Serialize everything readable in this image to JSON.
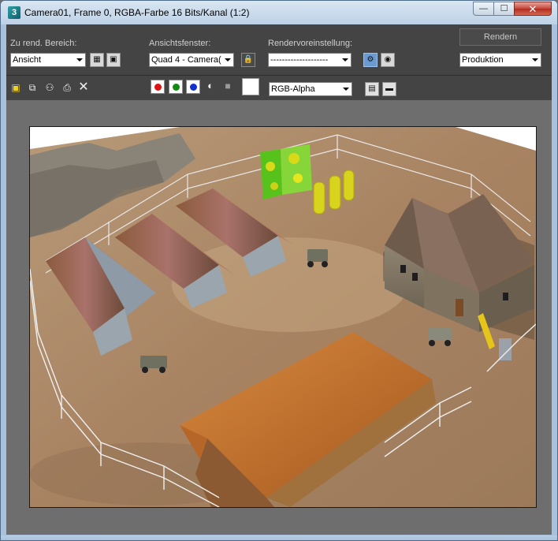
{
  "window": {
    "title": "Camera01, Frame 0, RGBA-Farbe 16 Bits/Kanal (1:2)",
    "app_icon_glyph": "3",
    "minimize_glyph": "—",
    "maximize_glyph": "☐",
    "close_glyph": "✕"
  },
  "toolbar": {
    "area_label": "Zu rend. Bereich:",
    "area_value": "Ansicht",
    "viewport_label": "Ansichtsfenster:",
    "viewport_value": "Quad 4 - Camera(",
    "preset_label": "Rendervoreinstellung:",
    "preset_value": "--------------------",
    "render_button": "Rendern",
    "mode_value": "Produktion"
  },
  "channels": {
    "display_value": "RGB-Alpha",
    "colors": {
      "red": "#e01010",
      "green": "#108a10",
      "blue": "#1030d0"
    }
  },
  "icons": {
    "area_edit": "crop-edit-icon",
    "area_auto": "auto-region-icon",
    "lock": "lock-icon",
    "render_setup": "render-setup-icon",
    "environment": "environment-icon",
    "save": "save-icon",
    "copy": "copy-image-icon",
    "clone": "clone-window-icon",
    "print": "print-icon",
    "clear": "clear-icon",
    "mono": "monochrome-icon",
    "alpha_toggle": "alpha-icon",
    "panel_toggle": "toggle-panel-icon",
    "frame_toggle": "frame-buffer-icon"
  },
  "colors": {
    "client_bg": "#444444",
    "viewport_bg": "#6e6e6e",
    "title_bg": "#bdd1e6"
  }
}
